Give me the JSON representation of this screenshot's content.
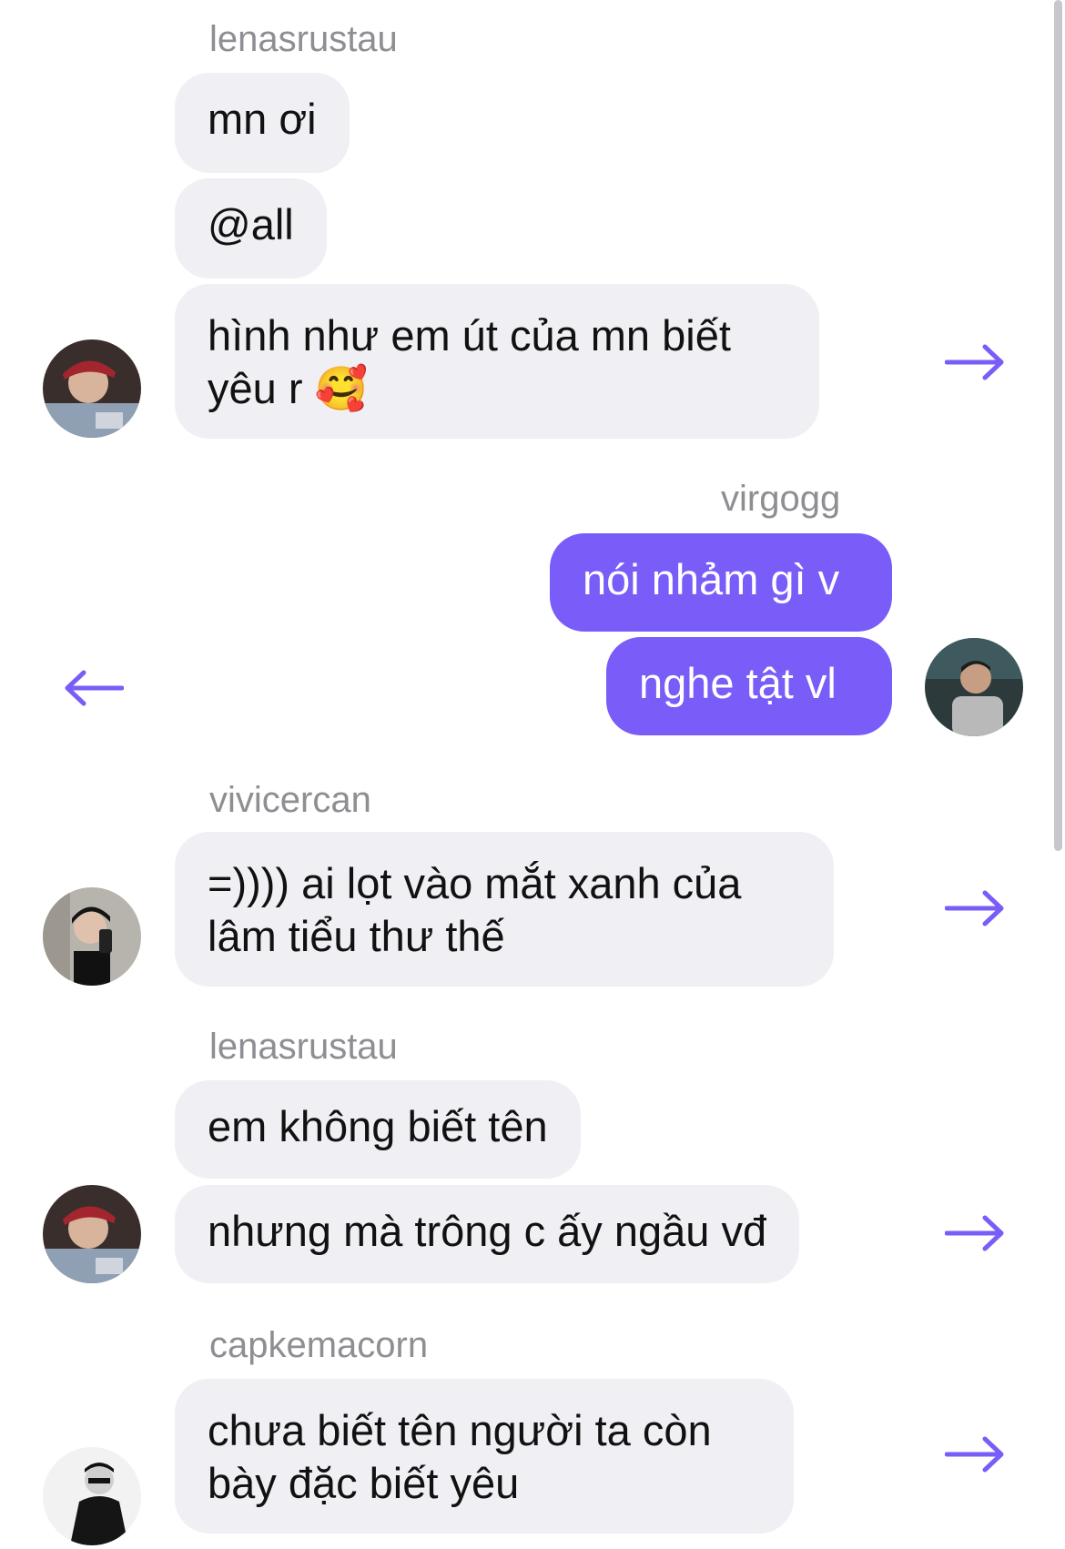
{
  "colors": {
    "accent": "#7a5cf8",
    "incoming_bubble": "#efeff4",
    "sender_text": "#8e8e93"
  },
  "messages": [
    {
      "sender": "lenasrustau",
      "bubbles": [
        "mn ơi",
        "@all",
        "hình như em út của mn biết yêu r 🥰"
      ],
      "direction": "incoming"
    },
    {
      "sender": "virgogg",
      "bubbles": [
        "nói nhảm gì v",
        "nghe tật vl"
      ],
      "direction": "outgoing"
    },
    {
      "sender": "vivicercan",
      "bubbles": [
        "=)))) ai lọt vào mắt xanh của lâm tiểu thư thế"
      ],
      "direction": "incoming"
    },
    {
      "sender": "lenasrustau",
      "bubbles": [
        "em không biết tên",
        "nhưng mà trông c ấy ngầu vđ"
      ],
      "direction": "incoming"
    },
    {
      "sender": "capkemacorn",
      "bubbles": [
        "chưa biết tên người ta còn bày đặc biết yêu"
      ],
      "direction": "incoming"
    }
  ]
}
